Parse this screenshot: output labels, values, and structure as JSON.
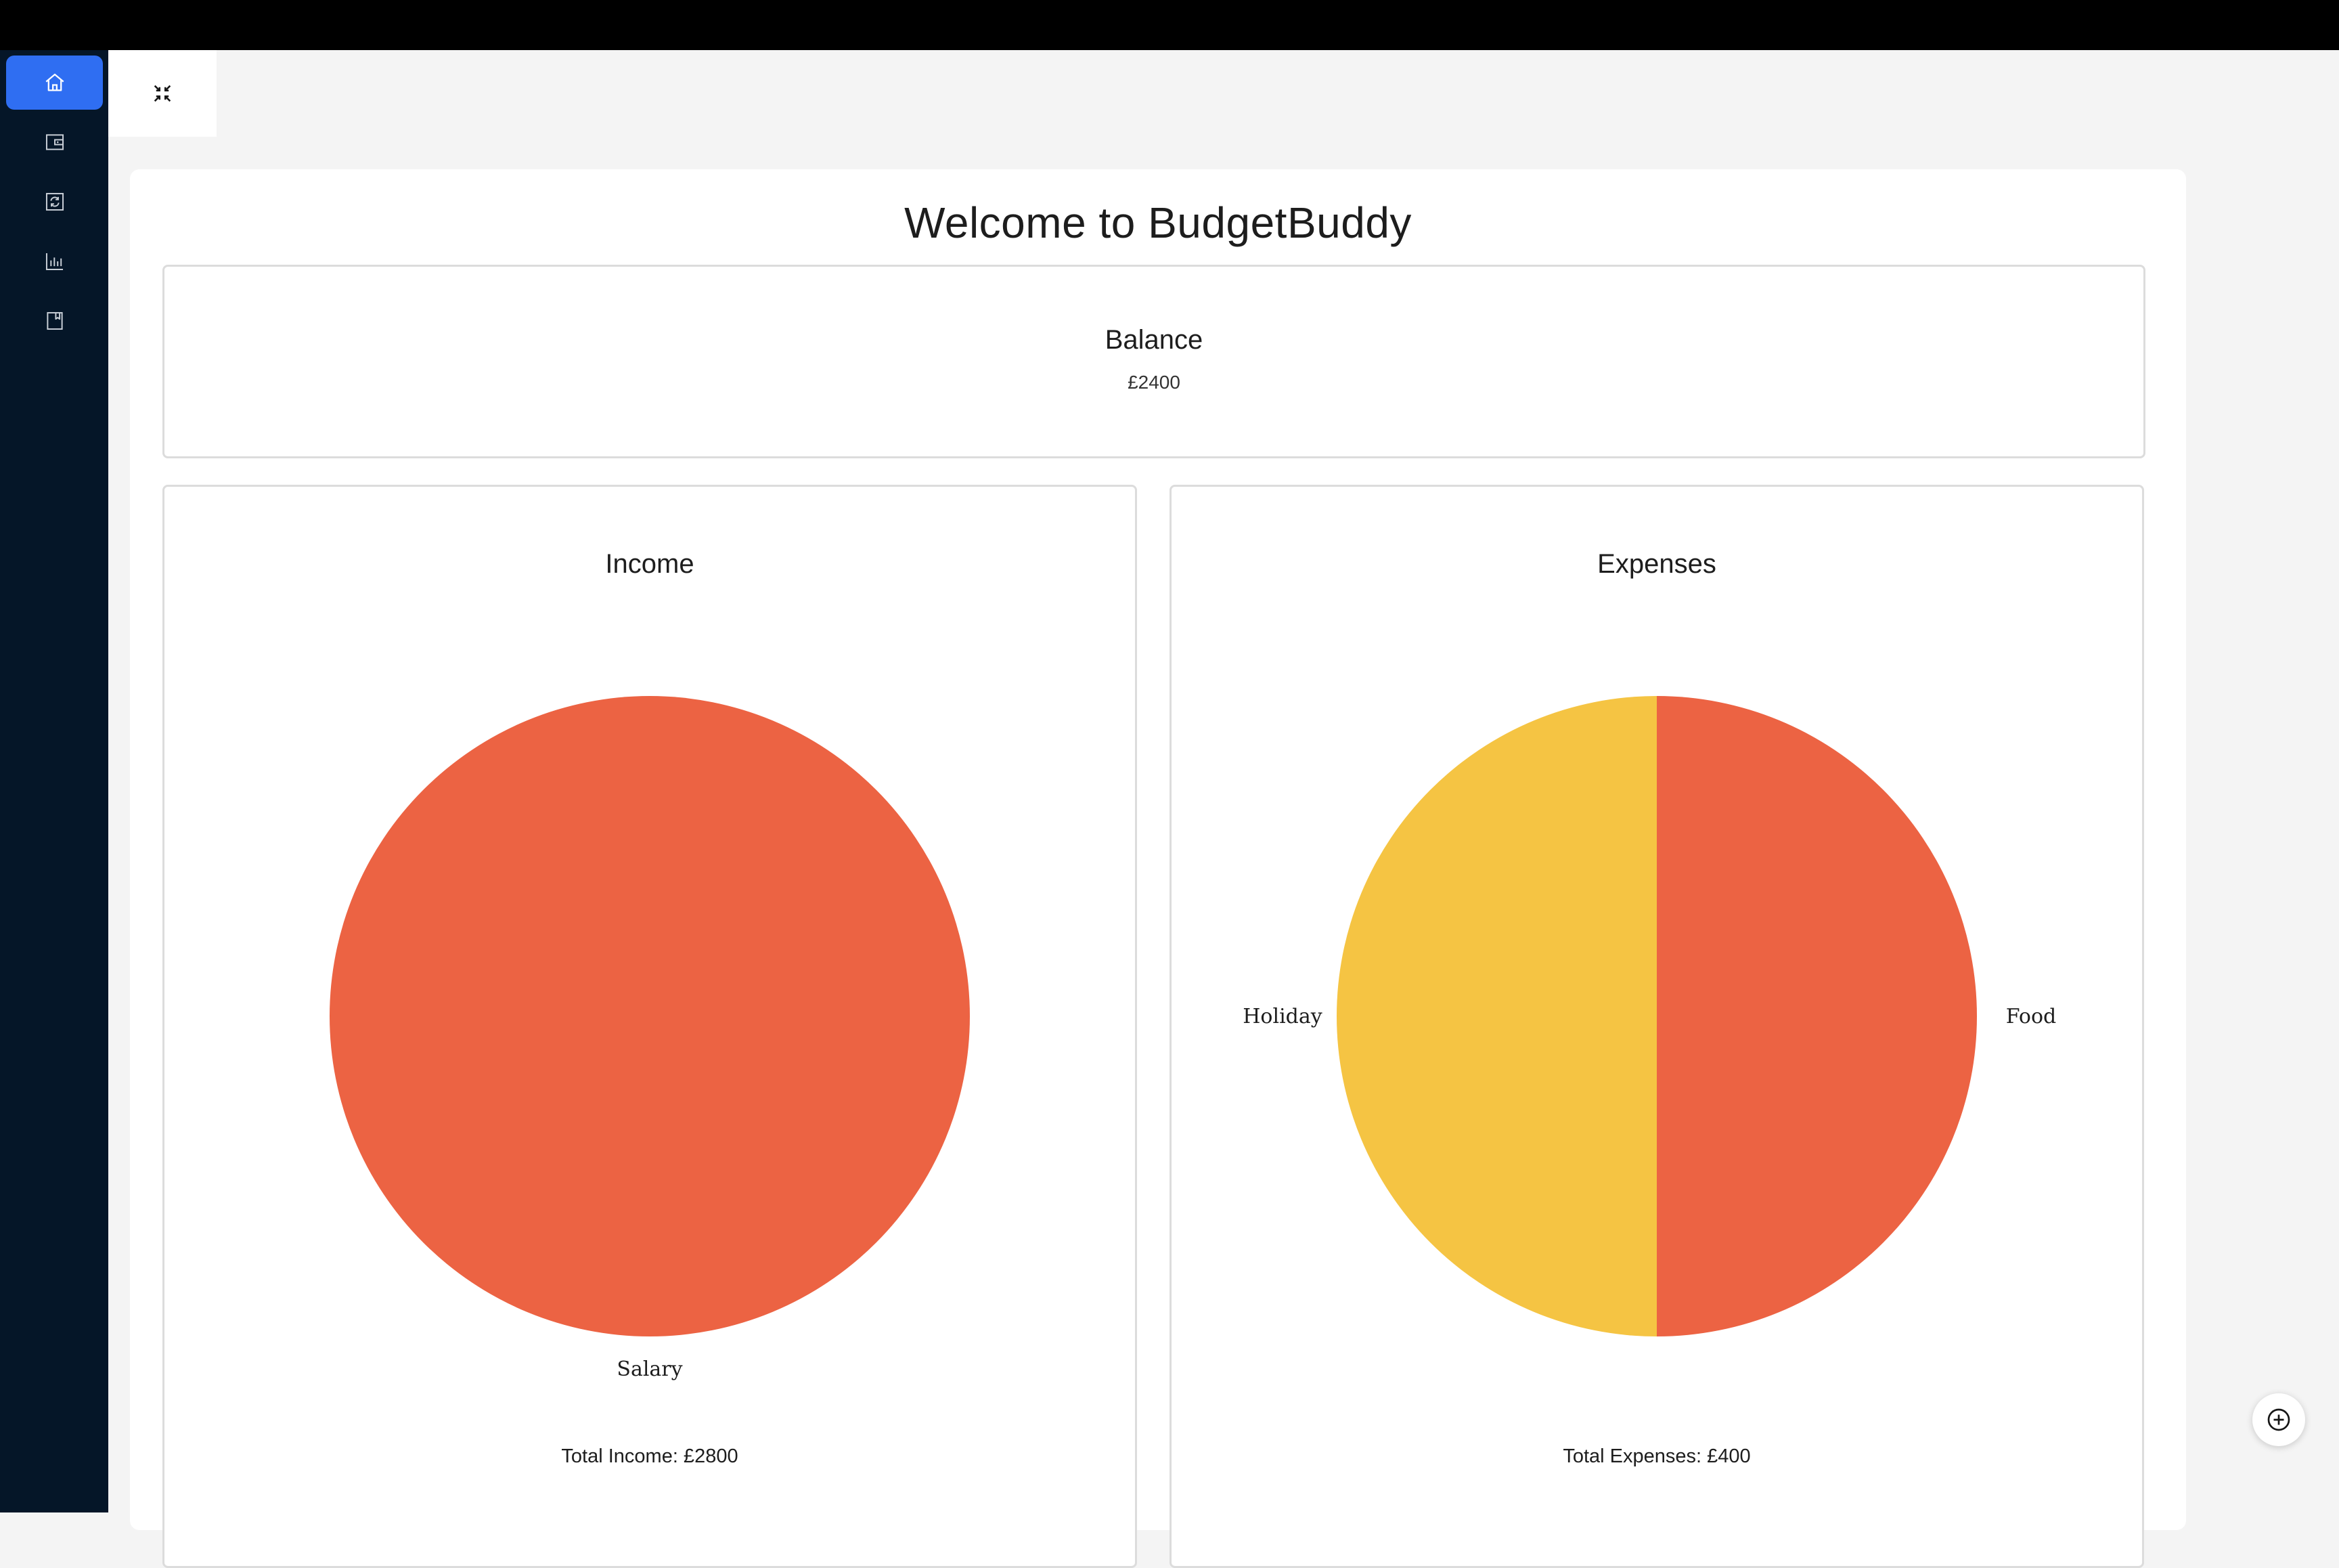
{
  "colors": {
    "sidebar_bg": "#051628",
    "active_nav": "#2f6ef2",
    "slice_orange": "#ec6343",
    "slice_yellow": "#f5c443"
  },
  "sidebar": {
    "items": [
      {
        "icon": "home-icon",
        "active": true
      },
      {
        "icon": "wallet-icon",
        "active": false
      },
      {
        "icon": "transactions-icon",
        "active": false
      },
      {
        "icon": "chart-icon",
        "active": false
      },
      {
        "icon": "bookmark-icon",
        "active": false
      }
    ]
  },
  "toolbar": {
    "collapse_icon": "collapse-icon"
  },
  "page": {
    "title": "Welcome to BudgetBuddy"
  },
  "balance": {
    "label": "Balance",
    "value": "£2400"
  },
  "income": {
    "title": "Income",
    "total": "Total Income: £2800"
  },
  "expenses": {
    "title": "Expenses",
    "total": "Total Expenses: £400"
  },
  "fab": {
    "icon": "add-circle-icon"
  },
  "chart_data": [
    {
      "type": "pie",
      "title": "Income",
      "categories": [
        "Salary"
      ],
      "values": [
        2800
      ],
      "colors": [
        "#ec6343"
      ]
    },
    {
      "type": "pie",
      "title": "Expenses",
      "categories": [
        "Food",
        "Holiday"
      ],
      "values": [
        200,
        200
      ],
      "colors": [
        "#ec6343",
        "#f5c443"
      ]
    }
  ]
}
